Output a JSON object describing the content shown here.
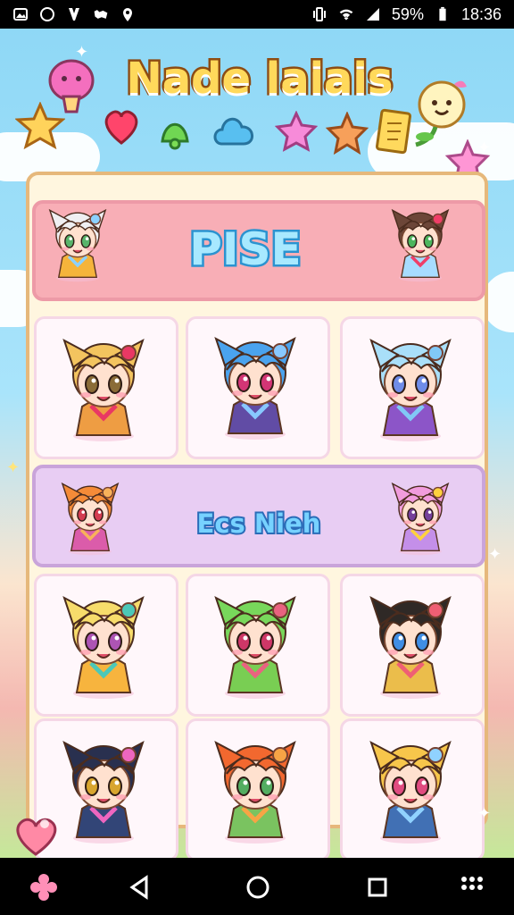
{
  "status_bar": {
    "battery_text": "59%",
    "time": "18:36"
  },
  "title": "Nade laiais",
  "colors": {
    "sky": "#8fd8f6",
    "panel": "#fff6df",
    "panel_border": "#e6b87b",
    "pink_banner": "#f8aeb6",
    "purple_banner": "#e8cdf3"
  },
  "top_icons": [
    "pink-jelly-icon",
    "yellow-star-icon",
    "red-heart-icon",
    "green-bell-icon",
    "blue-cloud-icon",
    "pink-star-icon",
    "orange-star-icon",
    "gold-card-icon",
    "smiley-flower-icon"
  ],
  "banners": {
    "top_label": "PISE",
    "middle_label": "Ecs Nieh"
  },
  "characters": [
    {
      "hair": "#efeff2",
      "eyes": "#58b46b",
      "outfit": "#f5b43b",
      "accent": "#8bd1ff"
    },
    {
      "hair": "#6c4638",
      "eyes": "#4cb65e",
      "outfit": "#a7dcff",
      "accent": "#ef3e68"
    },
    {
      "hair": "#f3c45f",
      "eyes": "#8a6c37",
      "outfit": "#ee9d43",
      "accent": "#e93864"
    },
    {
      "hair": "#4aa3ee",
      "eyes": "#d33575",
      "outfit": "#614ca5",
      "accent": "#88c8ff"
    },
    {
      "hair": "#a9dff9",
      "eyes": "#6e8ce8",
      "outfit": "#8c55c8",
      "accent": "#81c8f6"
    },
    {
      "hair": "#f58b38",
      "eyes": "#d43d51",
      "outfit": "#db5caa",
      "accent": "#f8b25a"
    },
    {
      "hair": "#f19cdd",
      "eyes": "#75409b",
      "outfit": "#c48fe9",
      "accent": "#ffd23e"
    },
    {
      "hair": "#f7dc6b",
      "eyes": "#ad54b4",
      "outfit": "#f7b43e",
      "accent": "#4cc8b8"
    },
    {
      "hair": "#78d85b",
      "eyes": "#cf3767",
      "outfit": "#79ce53",
      "accent": "#e96380"
    },
    {
      "hair": "#2f2926",
      "eyes": "#3f8ee5",
      "outfit": "#ebbd4b",
      "accent": "#ef5f74"
    },
    {
      "hair": "#29304f",
      "eyes": "#d8a52e",
      "outfit": "#324577",
      "accent": "#ee66c0"
    },
    {
      "hair": "#f2682f",
      "eyes": "#53ad61",
      "outfit": "#7ac360",
      "accent": "#f7a445"
    },
    {
      "hair": "#f7c64b",
      "eyes": "#e04b80",
      "outfit": "#4170b4",
      "accent": "#90d2ff"
    }
  ]
}
